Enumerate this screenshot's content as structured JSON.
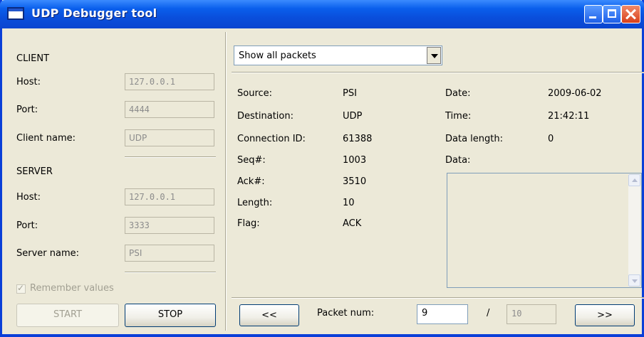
{
  "window": {
    "title": "UDP Debugger tool"
  },
  "client": {
    "heading": "CLIENT",
    "host_label": "Host:",
    "host_value": "127.0.0.1",
    "port_label": "Port:",
    "port_value": "4444",
    "name_label": "Client name:",
    "name_value": "UDP"
  },
  "server": {
    "heading": "SERVER",
    "host_label": "Host:",
    "host_value": "127.0.0.1",
    "port_label": "Port:",
    "port_value": "3333",
    "name_label": "Server name:",
    "name_value": "PSI"
  },
  "remember": {
    "label": "Remember values",
    "checked": true
  },
  "buttons": {
    "start": "START",
    "stop": "STOP",
    "prev": "<<",
    "next": ">>"
  },
  "filter": {
    "selected": "Show all packets"
  },
  "packet": {
    "source_label": "Source:",
    "source_value": "PSI",
    "destination_label": "Destination:",
    "destination_value": "UDP",
    "connid_label": "Connection ID:",
    "connid_value": "61388",
    "seq_label": "Seq#:",
    "seq_value": "1003",
    "ack_label": "Ack#:",
    "ack_value": "3510",
    "length_label": "Length:",
    "length_value": "10",
    "flag_label": "Flag:",
    "flag_value": "ACK",
    "date_label": "Date:",
    "date_value": "2009-06-02",
    "time_label": "Time:",
    "time_value": "21:42:11",
    "datalen_label": "Data length:",
    "datalen_value": "0",
    "data_label": "Data:"
  },
  "nav": {
    "packet_num_label": "Packet num:",
    "current": "9",
    "separator": "/",
    "total": "10"
  }
}
